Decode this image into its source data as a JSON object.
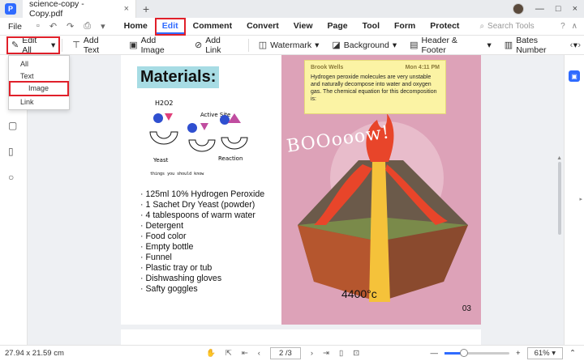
{
  "titlebar": {
    "doc_tab": "science-copy - Copy.pdf",
    "close": "×",
    "new_tab": "+",
    "min": "—",
    "max": "□",
    "close_win": "×"
  },
  "menubar": {
    "file": "File",
    "items": [
      "Home",
      "Edit",
      "Comment",
      "Convert",
      "View",
      "Page",
      "Tool",
      "Form",
      "Protect"
    ],
    "active": "Edit",
    "search_placeholder": "Search Tools"
  },
  "toolbar": {
    "edit_all": "Edit All",
    "add_text": "Add Text",
    "add_image": "Add Image",
    "add_link": "Add Link",
    "watermark": "Watermark",
    "background": "Background",
    "header_footer": "Header & Footer",
    "bates_number": "Bates Number"
  },
  "dropdown": {
    "items": [
      "All",
      "Text",
      "Image",
      "Link"
    ],
    "selected": "Image"
  },
  "page": {
    "heading": "Materials:",
    "diagram_labels": {
      "h2o2": "H2O2",
      "active_site": "Active Site",
      "yeast": "Yeast",
      "reaction": "Reaction",
      "caption": "things you should know"
    },
    "items": [
      "125ml 10% Hydrogen Peroxide",
      "1 Sachet Dry Yeast (powder)",
      "4 tablespoons of warm water",
      "Detergent",
      "Food color",
      "Empty bottle",
      "Funnel",
      "Plastic tray or tub",
      "Dishwashing gloves",
      "Safty goggles"
    ],
    "note": {
      "author": "Brook Wells",
      "time": "Mon 4:11 PM",
      "text": "Hydrogen peroxide molecules are very unstable and naturally decompose into water and oxygen gas. The chemical equation for this decomposition is:"
    },
    "boo_text": "BOOooow!",
    "temperature": "4400°c",
    "page_number": "03"
  },
  "statusbar": {
    "page_size": "27.94 x 21.59 cm",
    "page_indicator": "2 /3",
    "zoom": "61%",
    "zoom_fraction": 0.3
  },
  "colors": {
    "accent": "#2f6bff",
    "highlight": "#e0202a",
    "pink_panel": "#dda2b8",
    "note_bg": "#fbf3a4",
    "heading_bg": "#a7dce4"
  }
}
